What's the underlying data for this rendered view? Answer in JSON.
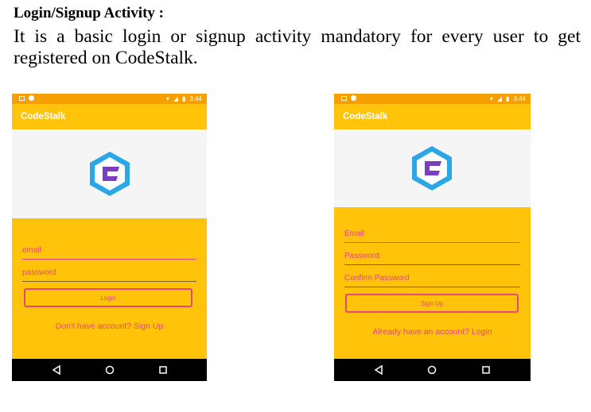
{
  "heading": "Login/Signup Activity :",
  "description": "It is a basic login or signup activity mandatory for every user to get registered on CodeStalk.",
  "colors": {
    "app_yellow": "#ffc30a",
    "status_orange": "#f5a000",
    "accent_pink": "#e8457a",
    "logo_blue": "#2aa7e6",
    "logo_purple": "#7a3fbf"
  },
  "phones": [
    {
      "status_time": "3:44",
      "app_title": "CodeStalk",
      "fields": [
        "email",
        "password"
      ],
      "button_label": "Login",
      "link_text": "Don't have account? Sign Up"
    },
    {
      "status_time": "3:44",
      "app_title": "CodeStalk",
      "fields": [
        "Email",
        "Password",
        "Confirm Password"
      ],
      "button_label": "Sign Up",
      "link_text": "Already have an account? Login"
    }
  ],
  "icons": {
    "back": "back-triangle-icon",
    "home": "home-circle-icon",
    "recents": "recents-square-icon"
  }
}
